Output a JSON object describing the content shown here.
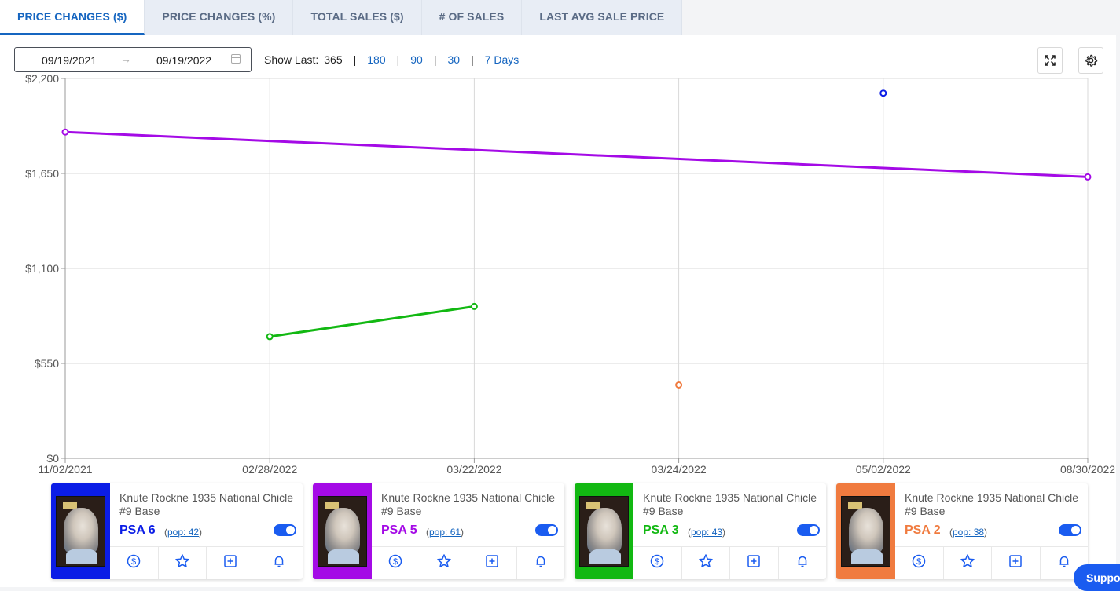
{
  "tabs": [
    {
      "label": "PRICE CHANGES ($)",
      "active": true
    },
    {
      "label": "PRICE CHANGES (%)",
      "active": false
    },
    {
      "label": "TOTAL SALES ($)",
      "active": false
    },
    {
      "label": "# OF SALES",
      "active": false
    },
    {
      "label": "LAST AVG SALE PRICE",
      "active": false
    }
  ],
  "toolbar": {
    "date_start": "09/19/2021",
    "date_end": "09/19/2022",
    "arrow": "→",
    "show_last_label": "Show Last:",
    "show_last_options": [
      "365",
      "180",
      "90",
      "30",
      "7 Days"
    ],
    "show_last_selected": "365",
    "separator": "|"
  },
  "chart_data": {
    "type": "line",
    "x_categories": [
      "11/02/2021",
      "02/28/2022",
      "03/22/2022",
      "03/24/2022",
      "05/02/2022",
      "08/30/2022"
    ],
    "y_ticks": [
      "$0",
      "$550",
      "$1,100",
      "$1,650",
      "$2,200"
    ],
    "ylim": [
      0,
      2200
    ],
    "grid": true,
    "series": [
      {
        "name": "PSA 6",
        "color": "#0b1de6",
        "points": [
          {
            "x": "05/02/2022",
            "y": 2115
          }
        ]
      },
      {
        "name": "PSA 5",
        "color": "#a40ae6",
        "points": [
          {
            "x": "11/02/2021",
            "y": 1890
          },
          {
            "x": "08/30/2022",
            "y": 1630
          }
        ]
      },
      {
        "name": "PSA 3",
        "color": "#12b812",
        "points": [
          {
            "x": "02/28/2022",
            "y": 705
          },
          {
            "x": "03/22/2022",
            "y": 880
          }
        ]
      },
      {
        "name": "PSA 2",
        "color": "#f07b3f",
        "points": [
          {
            "x": "03/24/2022",
            "y": 425
          }
        ]
      }
    ]
  },
  "cards": [
    {
      "title": "Knute Rockne 1935 National Chicle #9 Base",
      "grade": "PSA 6",
      "pop": "(pop: 42)",
      "pop_open": "(",
      "pop_link": "pop: 42",
      "pop_close": ")",
      "color": "#0b1de6",
      "enabled": true
    },
    {
      "title": "Knute Rockne 1935 National Chicle #9 Base",
      "grade": "PSA 5",
      "pop": "(pop: 61)",
      "pop_open": "(",
      "pop_link": "pop: 61",
      "pop_close": ")",
      "color": "#a40ae6",
      "enabled": true
    },
    {
      "title": "Knute Rockne 1935 National Chicle #9 Base",
      "grade": "PSA 3",
      "pop": "(pop: 43)",
      "pop_open": "(",
      "pop_link": "pop: 43",
      "pop_close": ")",
      "color": "#12b812",
      "enabled": true
    },
    {
      "title": "Knute Rockne 1935 National Chicle #9 Base",
      "grade": "PSA 2",
      "pop": "(pop: 38)",
      "pop_open": "(",
      "pop_link": "pop: 38",
      "pop_close": ")",
      "color": "#f07b3f",
      "enabled": true
    }
  ],
  "card_action_icons": [
    "dollar-icon",
    "star-icon",
    "add-square-icon",
    "bell-icon"
  ],
  "support": {
    "label": "Support"
  },
  "icons": {
    "fullscreen": "expand-icon",
    "settings": "gear-icon",
    "calendar": "calendar-icon"
  },
  "colors": {
    "accent": "#1565c0",
    "toggle": "#1a5cf0"
  }
}
